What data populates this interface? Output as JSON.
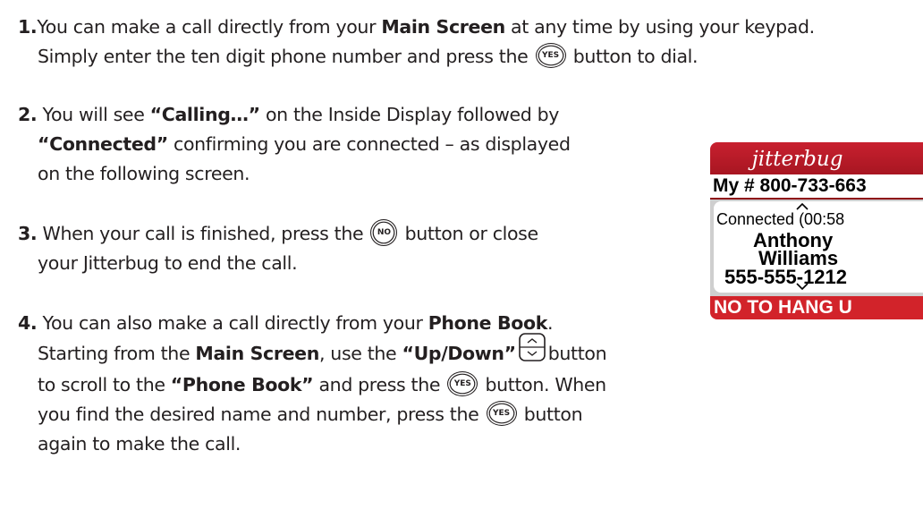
{
  "steps": [
    {
      "num": "1.",
      "t1": "You can make a call directly from your ",
      "b1": "Main Screen",
      "t2": " at any time by using your keypad.",
      "t3": "Simply enter the ten digit phone number and press the",
      "t4": "button to dial."
    },
    {
      "num": "2.",
      "t1": "You will see ",
      "b1": "“Calling…”",
      "t2": " on the Inside Display followed by",
      "b2": "“Connected”",
      "t3": " confirming you are connected – as displayed",
      "t4": "on the following screen."
    },
    {
      "num": "3.",
      "t1": "When your call is finished, press the",
      "t2": "button or close",
      "t3": "your Jitterbug to end the call."
    },
    {
      "num": "4.",
      "t1": "You can also make a call directly from your ",
      "b1": "Phone Book",
      "t1b": ".",
      "t2": "Starting from the ",
      "b2": "Main Screen",
      "t3": ", use the ",
      "b3": "“Up/Down”",
      "t4": "button",
      "t5": "to scroll to the ",
      "b4": "“Phone Book”",
      "t6": " and press the",
      "t7": "button. When",
      "t8": "you find the desired name and number, press the",
      "t9": "button",
      "t10": "again to make the call."
    }
  ],
  "keys": {
    "yes": "YES",
    "no": "NO"
  },
  "device": {
    "logo": "jitterbug",
    "my_number": "My # 800-733-663",
    "status": "Connected (00:58",
    "first_name": "Anthony",
    "last_name": "Williams",
    "phone": "555-555-1212",
    "footer": "NO TO HANG U",
    "colors": {
      "header": "#c8202f",
      "footer": "#d2232a"
    }
  },
  "icons": [
    "yes-button-icon",
    "no-button-icon",
    "up-down-button-icon",
    "chevron-up-icon",
    "chevron-down-icon"
  ]
}
